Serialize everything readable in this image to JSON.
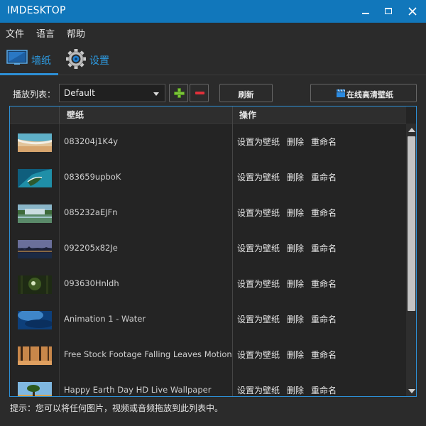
{
  "window": {
    "title": "IMDESKTOP"
  },
  "menu": [
    "文件",
    "语言",
    "帮助"
  ],
  "tabs": {
    "wallpaper": "墙纸",
    "settings": "设置"
  },
  "toolbar": {
    "playlist_label": "播放列表：",
    "playlist_value": "Default",
    "refresh_label": "刷新",
    "online_label": "在线高清壁纸"
  },
  "table": {
    "headers": {
      "wallpaper": "壁纸",
      "actions": "操作"
    },
    "rows": [
      {
        "name": "083204j1K4y",
        "thumb": "beach-icon"
      },
      {
        "name": "083659upboK",
        "thumb": "coast-aerial-icon"
      },
      {
        "name": "085232aEJFn",
        "thumb": "waterfall-icon"
      },
      {
        "name": "092205x82Je",
        "thumb": "city-night-icon"
      },
      {
        "name": "093630Hnldh",
        "thumb": "forest-icon"
      },
      {
        "name": "Animation 1 - Water",
        "thumb": "water-icon"
      },
      {
        "name": "Free Stock Footage Falling Leaves Motion Back",
        "thumb": "autumn-leaves-icon"
      },
      {
        "name": "Happy Earth Day HD Live Wallpaper",
        "thumb": "tree-sky-icon"
      }
    ],
    "actions": {
      "set": "设置为壁纸",
      "delete": "删除",
      "rename": "重命名"
    }
  },
  "hint": "提示：您可以将任何图片，视频或音频拖放到此列表中。",
  "colors": {
    "titlebar": "#1177bb",
    "accent": "#2d8fd5",
    "background": "#2b2b2b",
    "add": "#7cc43a",
    "remove": "#e0303a"
  }
}
